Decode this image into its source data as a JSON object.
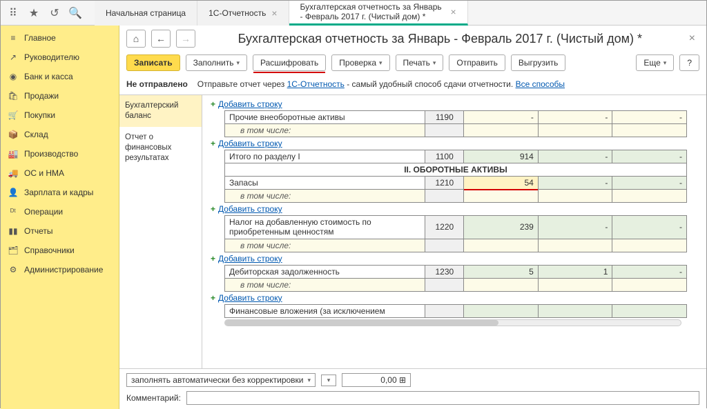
{
  "tabs": {
    "home": "Начальная страница",
    "reporting": "1С-Отчетность",
    "current": "Бухгалтерская отчетность за Январь - Февраль 2017 г. (Чистый дом) *"
  },
  "sidebar": [
    {
      "icon": "≡",
      "label": "Главное"
    },
    {
      "icon": "↗",
      "label": "Руководителю"
    },
    {
      "icon": "◉",
      "label": "Банк и касса"
    },
    {
      "icon": "🛍",
      "label": "Продажи"
    },
    {
      "icon": "🛒",
      "label": "Покупки"
    },
    {
      "icon": "📦",
      "label": "Склад"
    },
    {
      "icon": "🏭",
      "label": "Производство"
    },
    {
      "icon": "🚚",
      "label": "ОС и НМА"
    },
    {
      "icon": "👤",
      "label": "Зарплата и кадры"
    },
    {
      "icon": "ᴰᵗ",
      "label": "Операции"
    },
    {
      "icon": "▮▮",
      "label": "Отчеты"
    },
    {
      "icon": "🗂",
      "label": "Справочники"
    },
    {
      "icon": "⚙",
      "label": "Администрирование"
    }
  ],
  "page": {
    "title": "Бухгалтерская отчетность за Январь - Февраль 2017 г. (Чистый дом) *"
  },
  "actions": {
    "save": "Записать",
    "fill": "Заполнить",
    "decode": "Расшифровать",
    "check": "Проверка",
    "print": "Печать",
    "send": "Отправить",
    "export": "Выгрузить",
    "more": "Еще"
  },
  "status": {
    "state": "Не отправлено",
    "hint_pre": "Отправьте отчет через ",
    "hint_link": "1С-Отчетность",
    "hint_post": " - самый удобный способ сдачи отчетности. ",
    "all_ways": "Все способы"
  },
  "secnav": {
    "balance": "Бухгалтерский баланс",
    "finres": "Отчет о финансовых результатах"
  },
  "addrow": "Добавить строку",
  "rows": {
    "other_nca": {
      "label": "Прочие внеоборотные активы",
      "code": "1190",
      "sub": "в том числе:"
    },
    "total1": {
      "label": "Итого по разделу I",
      "code": "1100",
      "v1": "914"
    },
    "sec2": "II. ОБОРОТНЫЕ АКТИВЫ",
    "stocks": {
      "label": "Запасы",
      "code": "1210",
      "v1": "54",
      "sub": "в том числе:"
    },
    "vat": {
      "label": "Налог на добавленную стоимость по приобретенным ценностям",
      "code": "1220",
      "v1": "239",
      "sub": "в том числе:"
    },
    "debit": {
      "label": "Дебиторская задолженность",
      "code": "1230",
      "v1": "5",
      "v2": "1",
      "sub": "в том числе:"
    },
    "fin": {
      "label": "Финансовые вложения (за исключением"
    }
  },
  "footer": {
    "mode": "заполнять автоматически без корректировки",
    "num": "0,00",
    "comment_label": "Комментарий:"
  }
}
